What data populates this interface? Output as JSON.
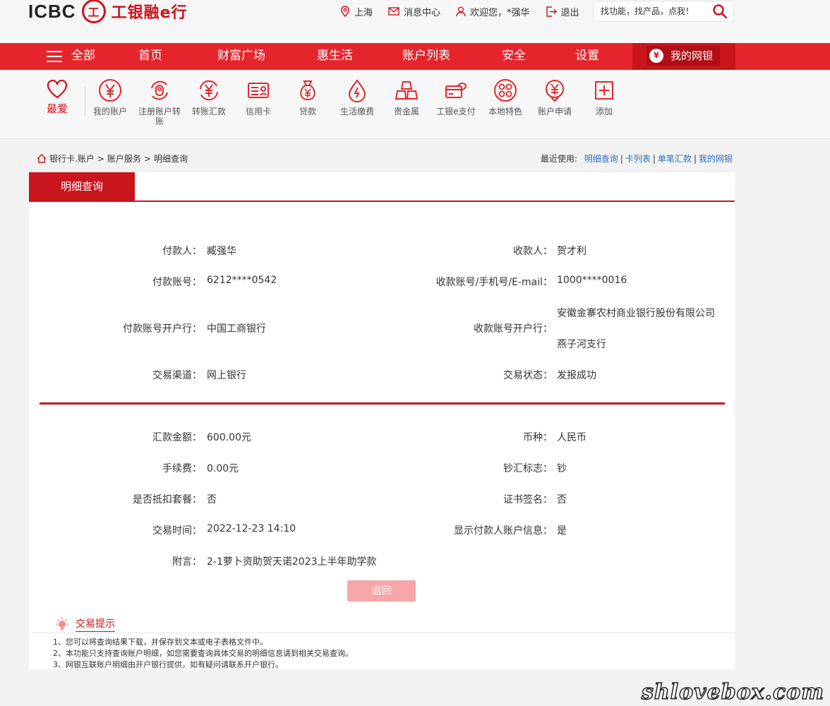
{
  "header": {
    "logo_text": "ICBC",
    "brand_name": "工银融e行",
    "seal_char": "工",
    "links": [
      {
        "label": "上海",
        "icon": "location-icon"
      },
      {
        "label": "消息中心",
        "icon": "mail-icon"
      },
      {
        "label": "欢迎您，*强华",
        "icon": "user-icon"
      },
      {
        "label": "退出",
        "icon": "logout-icon"
      }
    ],
    "search_placeholder": "找功能，找产品，点我！"
  },
  "nav": {
    "all_label": "全部",
    "items": [
      "首页",
      "财富广场",
      "惠生活",
      "账户列表",
      "安全",
      "设置"
    ],
    "mybank_label": "我的网银"
  },
  "quickbar": {
    "favorite_label": "最爱",
    "items": [
      {
        "label": "我的账户",
        "icon": "yuan-coin-icon"
      },
      {
        "label": "注册账户转账",
        "icon": "transfer-register-icon"
      },
      {
        "label": "转账汇款",
        "icon": "transfer-icon"
      },
      {
        "label": "信用卡",
        "icon": "credit-card-icon"
      },
      {
        "label": "贷款",
        "icon": "loan-bag-icon"
      },
      {
        "label": "生活缴费",
        "icon": "utility-drop-icon"
      },
      {
        "label": "贵金属",
        "icon": "gold-bars-icon"
      },
      {
        "label": "工银e支付",
        "icon": "epay-icon"
      },
      {
        "label": "本地特色",
        "icon": "local-feature-icon"
      },
      {
        "label": "账户申请",
        "icon": "account-apply-icon"
      },
      {
        "label": "添加",
        "icon": "add-icon"
      }
    ]
  },
  "breadcrumb": {
    "items": [
      "银行卡.账户",
      "账户服务",
      "明细查询"
    ],
    "separator": ">"
  },
  "recent": {
    "label": "最近使用:",
    "links": [
      "明细查询",
      "卡列表",
      "单笔汇款",
      "我的网银"
    ]
  },
  "panel": {
    "tab_label": "明细查询",
    "fields": {
      "payer_label": "付款人：",
      "payer": "臧强华",
      "payee_label": "收款人：",
      "payee": "贺才利",
      "payer_acct_label": "付款账号：",
      "payer_acct": "6212****0542",
      "payee_acct_label": "收款账号/手机号/E-mail：",
      "payee_acct": "1000****0016",
      "payer_bank_label": "付款账号开户行：",
      "payer_bank": "中国工商银行",
      "payee_bank_label": "收款账号开户行：",
      "payee_bank_line1": "安徽金寨农村商业银行股份有限公司",
      "payee_bank_line2": "燕子河支行",
      "channel_label": "交易渠道：",
      "channel": "网上银行",
      "status_label": "交易状态：",
      "status": "发报成功",
      "amount_label": "汇款金额：",
      "amount": "600.00元",
      "currency_label": "币种：",
      "currency": "人民币",
      "fee_label": "手续费：",
      "fee": "0.00元",
      "cash_flag_label": "钞汇标志：",
      "cash_flag": "钞",
      "package_label": "是否抵扣套餐：",
      "package": "否",
      "cert_label": "证书签名：",
      "cert": "否",
      "time_label": "交易时间：",
      "time": "2022-12-23 14:10",
      "show_payer_label": "显示付款人账户信息：",
      "show_payer": "是",
      "memo_label": "附言：",
      "memo": "2-1萝卜资助贺天诺2023上半年助学款"
    },
    "back_label": "返回",
    "tips_title": "交易提示",
    "tips": [
      "1、您可以将查询结果下载，并保存到文本或电子表格文件中。",
      "2、本功能只支持查询账户明细，如您需要查询具体交易的明细信息请到相关交易查询。",
      "3、网银互联账户明细由开户银行提供，如有疑问请联系开户银行。"
    ]
  },
  "watermark": "shlovebox.com",
  "colors": {
    "brand_red": "#e5252c",
    "dark_red": "#c9151c",
    "link_blue": "#2a6fbf",
    "button_pink": "#f7a6a8"
  }
}
